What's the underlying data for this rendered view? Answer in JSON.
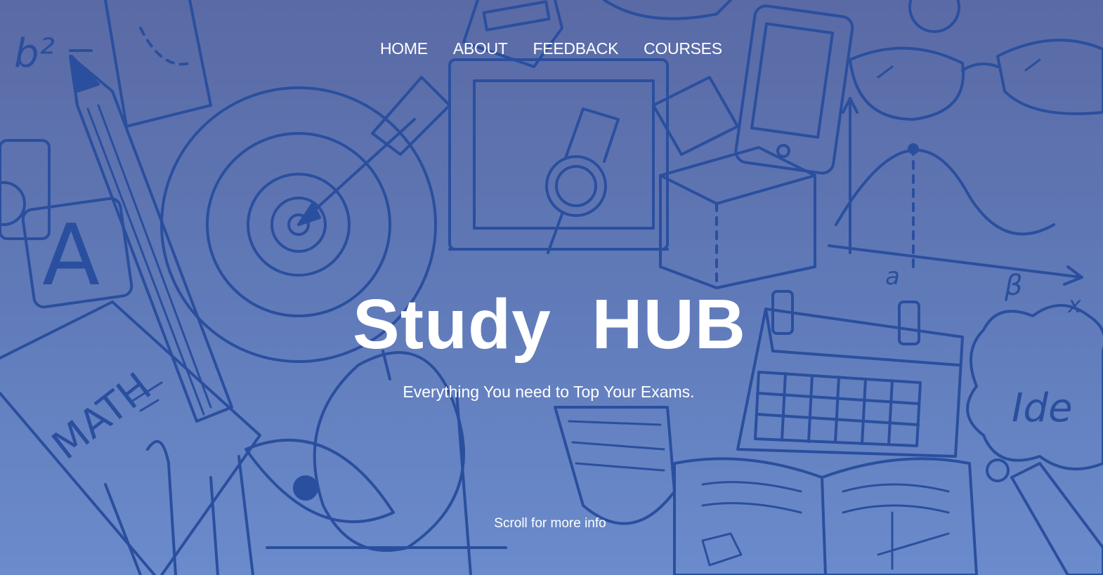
{
  "nav": {
    "items": [
      {
        "label": "HOME"
      },
      {
        "label": "ABOUT"
      },
      {
        "label": "FEEDBACK"
      },
      {
        "label": "COURSES"
      }
    ]
  },
  "hero": {
    "title": "Study  HUB",
    "tagline": "Everything You need to Top Your Exams.",
    "scroll_hint": "Scroll for more info",
    "background_illustration": "study-doodles-background",
    "colors": {
      "background_top": "#5a6aa5",
      "background_bottom": "#6a8bcc",
      "doodle_stroke": "#2a4f9e",
      "text": "#ffffff"
    }
  },
  "doodle_text": {
    "math_book": "MATH",
    "idea_cloud": "Ide",
    "formula": "b²",
    "letter_block": "A"
  }
}
